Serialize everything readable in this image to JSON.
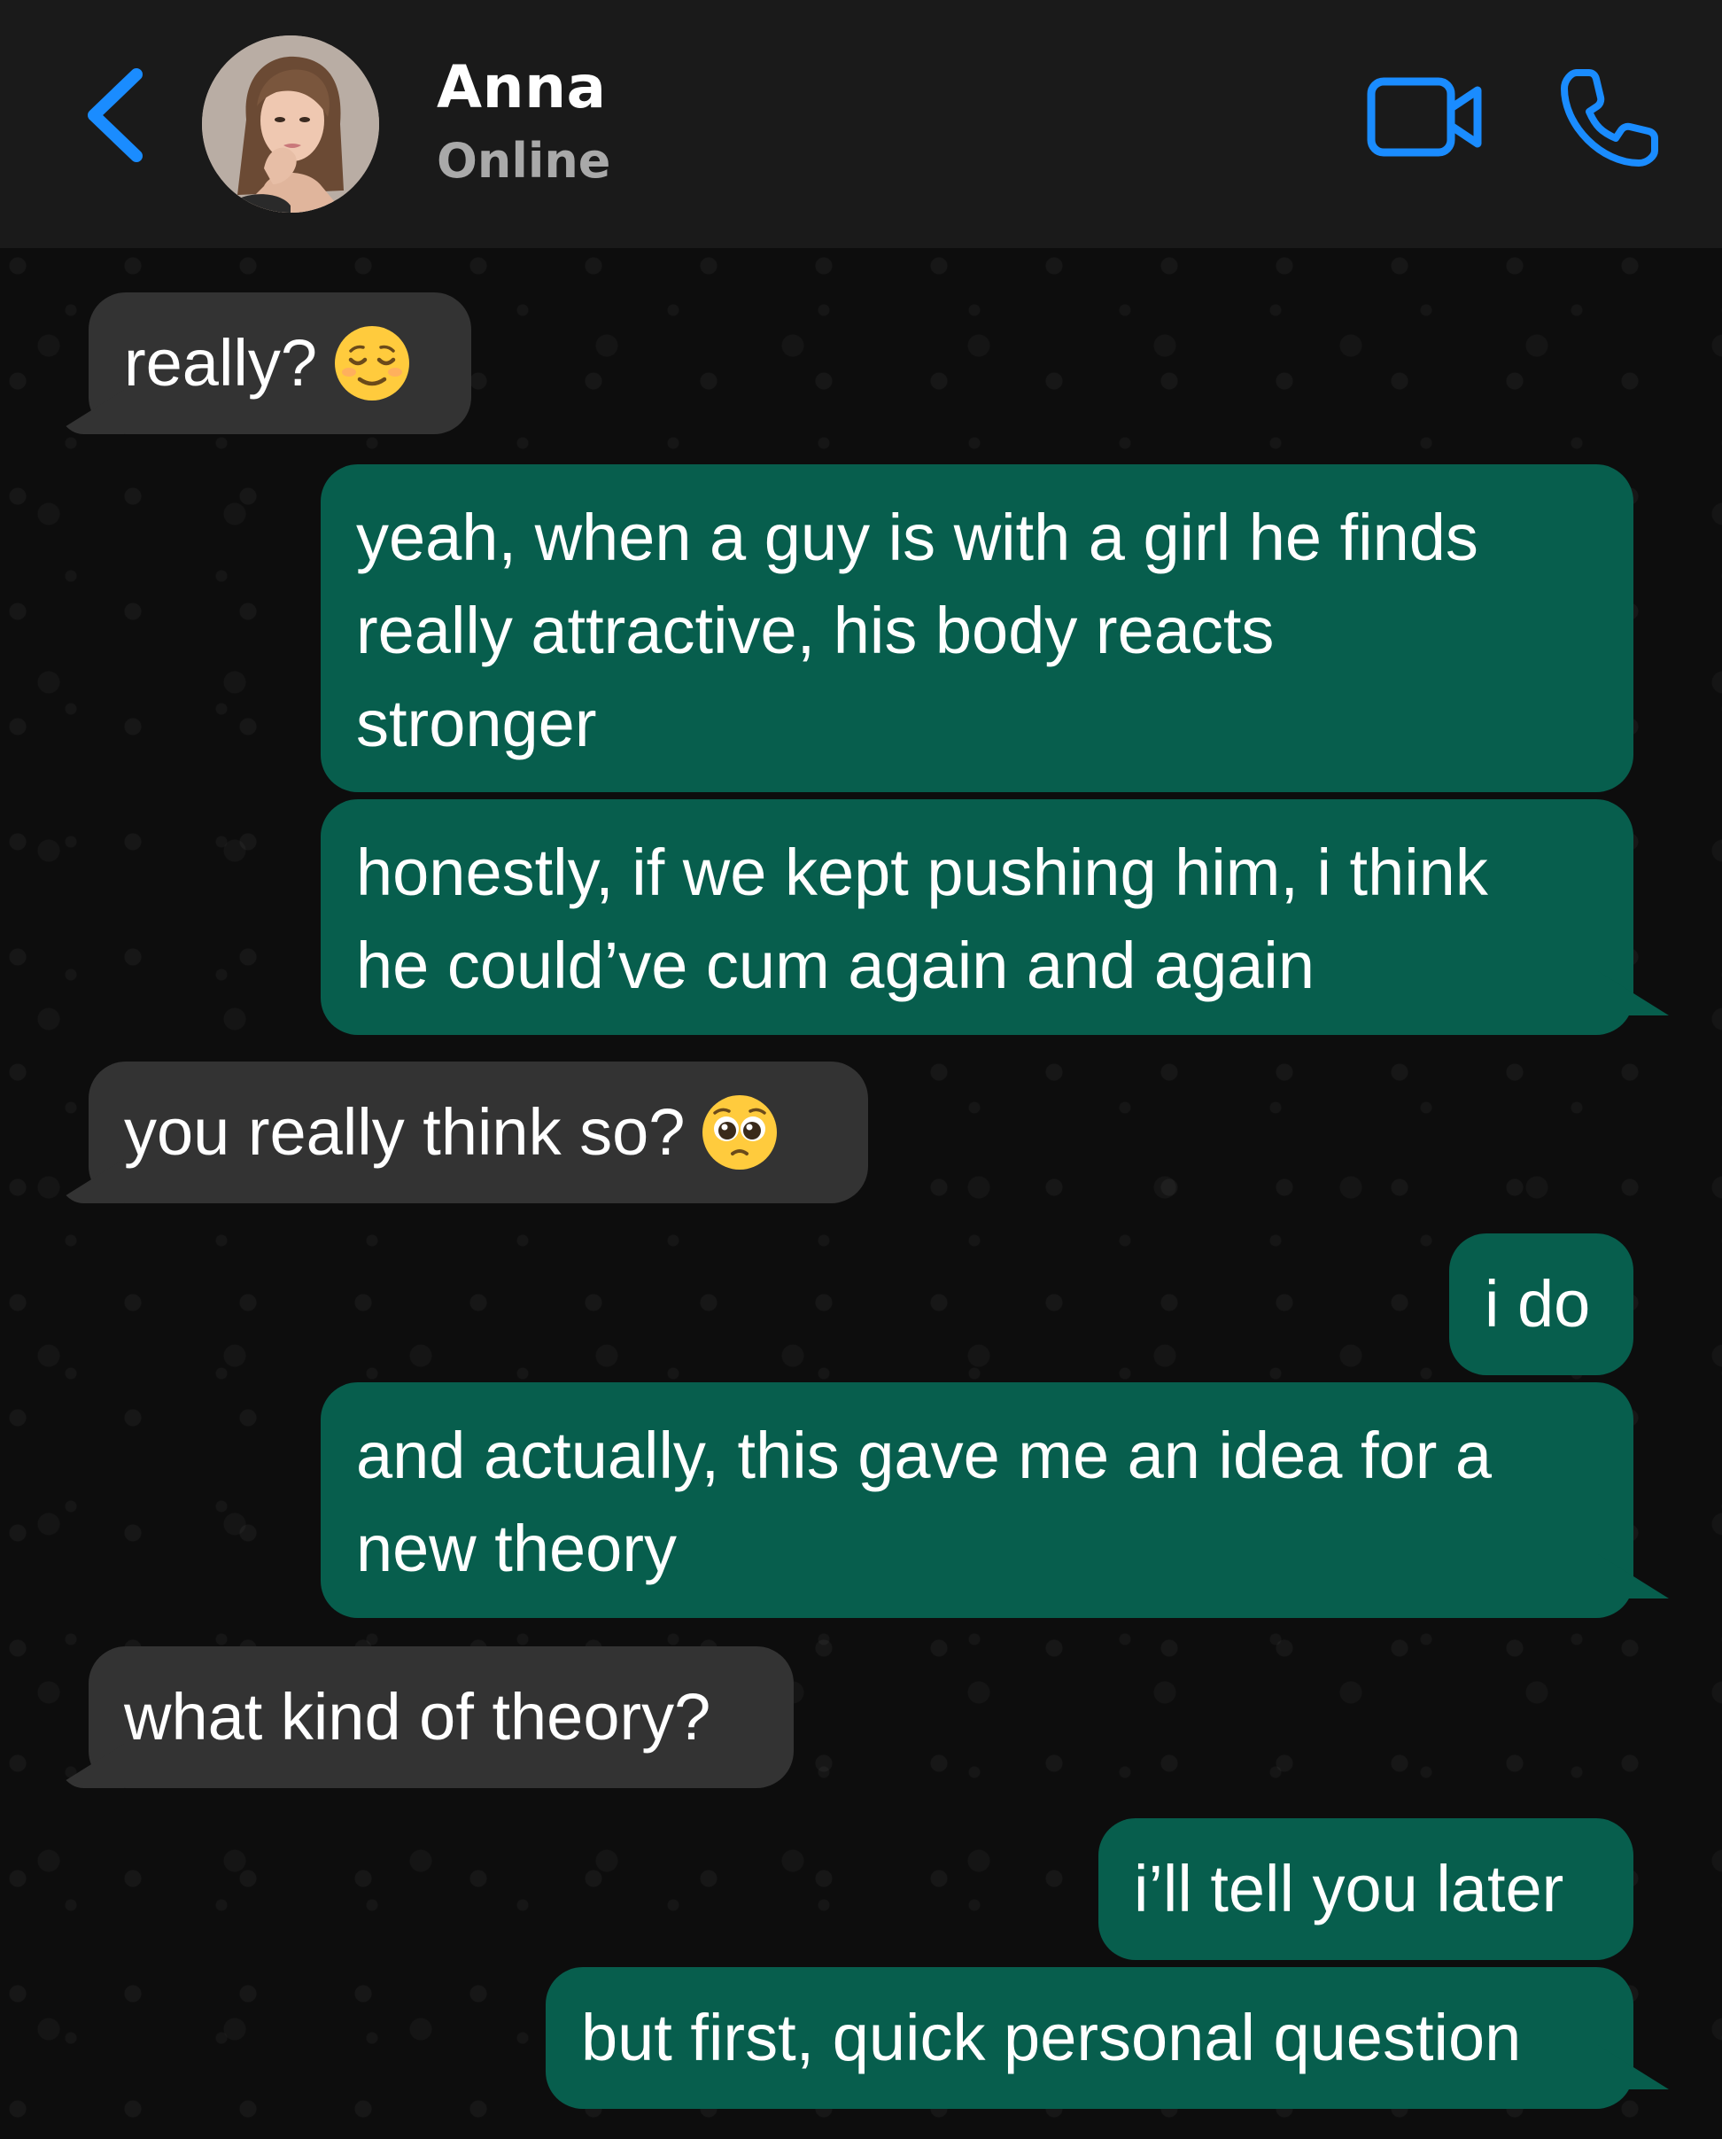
{
  "header": {
    "contact_name": "Anna",
    "contact_status": "Online",
    "back_icon": "chevron-left-icon",
    "video_icon": "video-camera-icon",
    "call_icon": "phone-icon",
    "accent_color": "#1a8cff"
  },
  "messages": [
    {
      "direction": "incoming",
      "lines": [
        "really?"
      ],
      "emoji": "relieved-face-emoji"
    },
    {
      "direction": "outgoing",
      "lines": [
        "yeah, when a guy is with a girl he finds",
        "really attractive, his body reacts",
        "stronger"
      ]
    },
    {
      "direction": "outgoing",
      "lines": [
        "honestly, if we kept pushing him, i think",
        "he could’ve cum again and again"
      ]
    },
    {
      "direction": "incoming",
      "lines": [
        "you really think so?"
      ],
      "emoji": "pleading-face-emoji"
    },
    {
      "direction": "outgoing",
      "lines": [
        "i do"
      ]
    },
    {
      "direction": "outgoing",
      "lines": [
        "and actually, this gave me an idea for a",
        "new theory"
      ]
    },
    {
      "direction": "incoming",
      "lines": [
        "what kind of theory?"
      ]
    },
    {
      "direction": "outgoing",
      "lines": [
        "i’ll tell you later"
      ]
    },
    {
      "direction": "outgoing",
      "lines": [
        "but first, quick personal question"
      ]
    }
  ],
  "colors": {
    "incoming_bubble": "#333333",
    "outgoing_bubble": "#075e4d",
    "header_bg": "#1a1a1a",
    "chat_bg": "#0d0d0d"
  }
}
